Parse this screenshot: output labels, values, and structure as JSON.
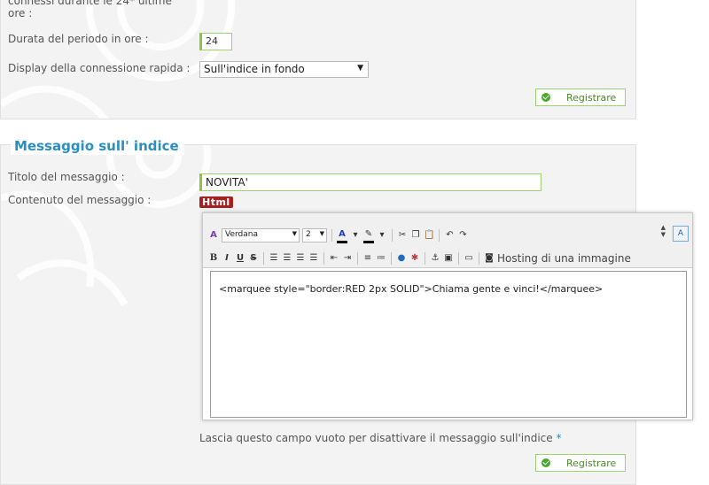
{
  "top_section": {
    "label_hours_partial": "connessi durante le 24* ultime ore :",
    "label_duration": "Durata del periodo in ore :",
    "duration_value": "24",
    "label_quick_display": "Display della connessione rapida :",
    "quick_display_value": "Sull'indice in fondo",
    "save_label": "Registrare"
  },
  "index_message": {
    "section_title": "Messaggio sull' indice",
    "label_title": "Titolo del messaggio :",
    "title_value": "NOVITA'",
    "label_content": "Contenuto del messaggio :",
    "html_badge": "Html",
    "editor": {
      "font_family": "Verdana",
      "font_size": "2",
      "hosting_label": "Hosting di una immagine",
      "content": "<marquee style=\"border:RED 2px SOLID\">Chiama gente e vinci!</marquee>"
    },
    "hint_text": "Lascia questo campo vuoto per disattivare il messaggio sull'indice",
    "hint_star": "*",
    "save_label": "Registrare"
  },
  "colors": {
    "accent_blue": "#2a8fbe",
    "input_green": "#8cc63f",
    "panel_bg": "#f3f3f3"
  }
}
